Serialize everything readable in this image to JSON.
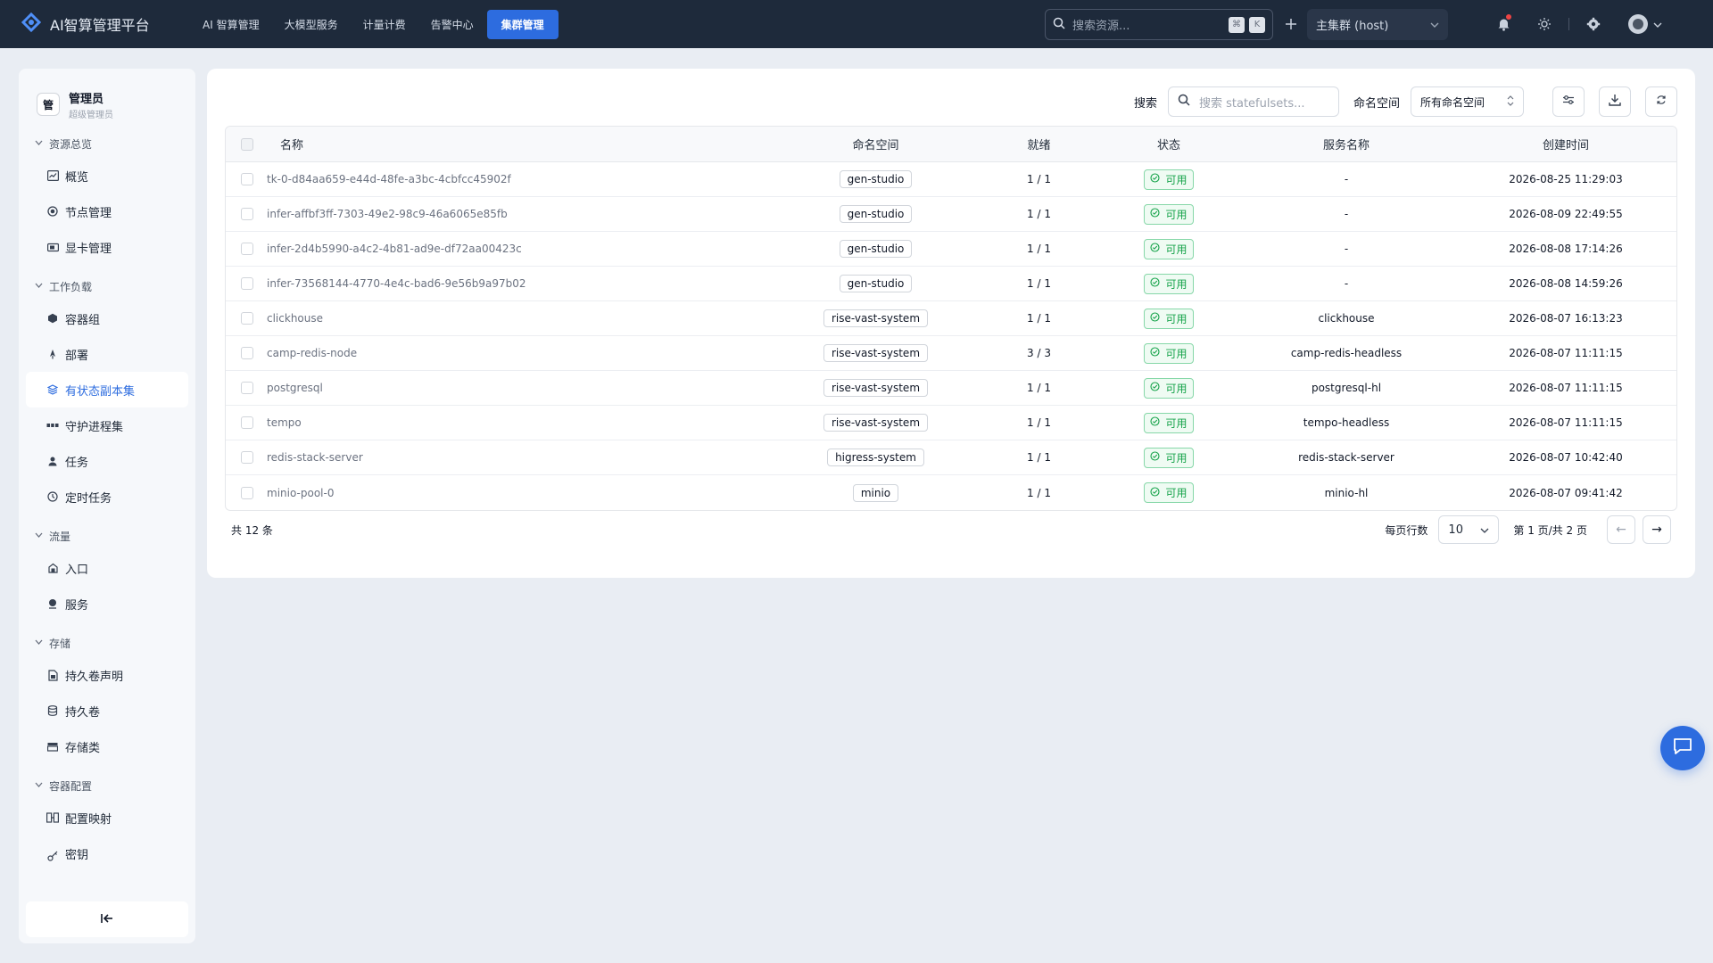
{
  "app": {
    "title": "AI智算管理平台",
    "brand_color": "#2d6cdf"
  },
  "topnav": {
    "items": [
      {
        "label": "AI 智算管理"
      },
      {
        "label": "大模型服务"
      },
      {
        "label": "计量计费"
      },
      {
        "label": "告警中心"
      },
      {
        "label": "集群管理",
        "active": true
      }
    ]
  },
  "top_search": {
    "placeholder": "搜索资源...",
    "kbd1": "⌘",
    "kbd2": "K"
  },
  "cluster_select": {
    "value": "主集群 (host)"
  },
  "user": {
    "avatar_text": "管",
    "name": "管理员",
    "role": "超级管理员"
  },
  "sidebar": {
    "groups": [
      {
        "title": "资源总览",
        "items": [
          {
            "label": "概览",
            "icon": "dashboard-icon"
          },
          {
            "label": "节点管理",
            "icon": "node-icon"
          },
          {
            "label": "显卡管理",
            "icon": "gpu-icon"
          }
        ]
      },
      {
        "title": "工作负载",
        "items": [
          {
            "label": "容器组",
            "icon": "pod-icon"
          },
          {
            "label": "部署",
            "icon": "deployment-icon"
          },
          {
            "label": "有状态副本集",
            "icon": "statefulset-icon",
            "active": true
          },
          {
            "label": "守护进程集",
            "icon": "daemonset-icon"
          },
          {
            "label": "任务",
            "icon": "job-icon"
          },
          {
            "label": "定时任务",
            "icon": "cronjob-icon"
          }
        ]
      },
      {
        "title": "流量",
        "items": [
          {
            "label": "入口",
            "icon": "ingress-icon"
          },
          {
            "label": "服务",
            "icon": "service-icon"
          }
        ]
      },
      {
        "title": "存储",
        "items": [
          {
            "label": "持久卷声明",
            "icon": "pvc-icon"
          },
          {
            "label": "持久卷",
            "icon": "pv-icon"
          },
          {
            "label": "存储类",
            "icon": "storageclass-icon"
          }
        ]
      },
      {
        "title": "容器配置",
        "items": [
          {
            "label": "配置映射",
            "icon": "configmap-icon"
          },
          {
            "label": "密钥",
            "icon": "secret-icon"
          }
        ]
      }
    ]
  },
  "toolbar": {
    "search_label": "搜索",
    "search_placeholder": "搜索 statefulsets...",
    "ns_label": "命名空间",
    "ns_value": "所有命名空间"
  },
  "table": {
    "headers": {
      "name": "名称",
      "namespace": "命名空间",
      "ready": "就绪",
      "status": "状态",
      "service": "服务名称",
      "created": "创建时间"
    },
    "rows": [
      {
        "name": "tk-0-d84aa659-e44d-48fe-a3bc-4cbfcc45902f",
        "namespace": "gen-studio",
        "ready": "1 / 1",
        "status": "可用",
        "service": "-",
        "created": "2026-08-25 11:29:03"
      },
      {
        "name": "infer-affbf3ff-7303-49e2-98c9-46a6065e85fb",
        "namespace": "gen-studio",
        "ready": "1 / 1",
        "status": "可用",
        "service": "-",
        "created": "2026-08-09 22:49:55"
      },
      {
        "name": "infer-2d4b5990-a4c2-4b81-ad9e-df72aa00423c",
        "namespace": "gen-studio",
        "ready": "1 / 1",
        "status": "可用",
        "service": "-",
        "created": "2026-08-08 17:14:26"
      },
      {
        "name": "infer-73568144-4770-4e4c-bad6-9e56b9a97b02",
        "namespace": "gen-studio",
        "ready": "1 / 1",
        "status": "可用",
        "service": "-",
        "created": "2026-08-08 14:59:26"
      },
      {
        "name": "clickhouse",
        "namespace": "rise-vast-system",
        "ready": "1 / 1",
        "status": "可用",
        "service": "clickhouse",
        "created": "2026-08-07 16:13:23"
      },
      {
        "name": "camp-redis-node",
        "namespace": "rise-vast-system",
        "ready": "3 / 3",
        "status": "可用",
        "service": "camp-redis-headless",
        "created": "2026-08-07 11:11:15"
      },
      {
        "name": "postgresql",
        "namespace": "rise-vast-system",
        "ready": "1 / 1",
        "status": "可用",
        "service": "postgresql-hl",
        "created": "2026-08-07 11:11:15"
      },
      {
        "name": "tempo",
        "namespace": "rise-vast-system",
        "ready": "1 / 1",
        "status": "可用",
        "service": "tempo-headless",
        "created": "2026-08-07 11:11:15"
      },
      {
        "name": "redis-stack-server",
        "namespace": "higress-system",
        "ready": "1 / 1",
        "status": "可用",
        "service": "redis-stack-server",
        "created": "2026-08-07 10:42:40"
      },
      {
        "name": "minio-pool-0",
        "namespace": "minio",
        "ready": "1 / 1",
        "status": "可用",
        "service": "minio-hl",
        "created": "2026-08-07 09:41:42"
      }
    ]
  },
  "pagination": {
    "total": "共 12 条",
    "rows_label": "每页行数",
    "rows_value": "10",
    "page_info": "第 1 页/共 2 页",
    "prev": "←",
    "next": "→"
  }
}
